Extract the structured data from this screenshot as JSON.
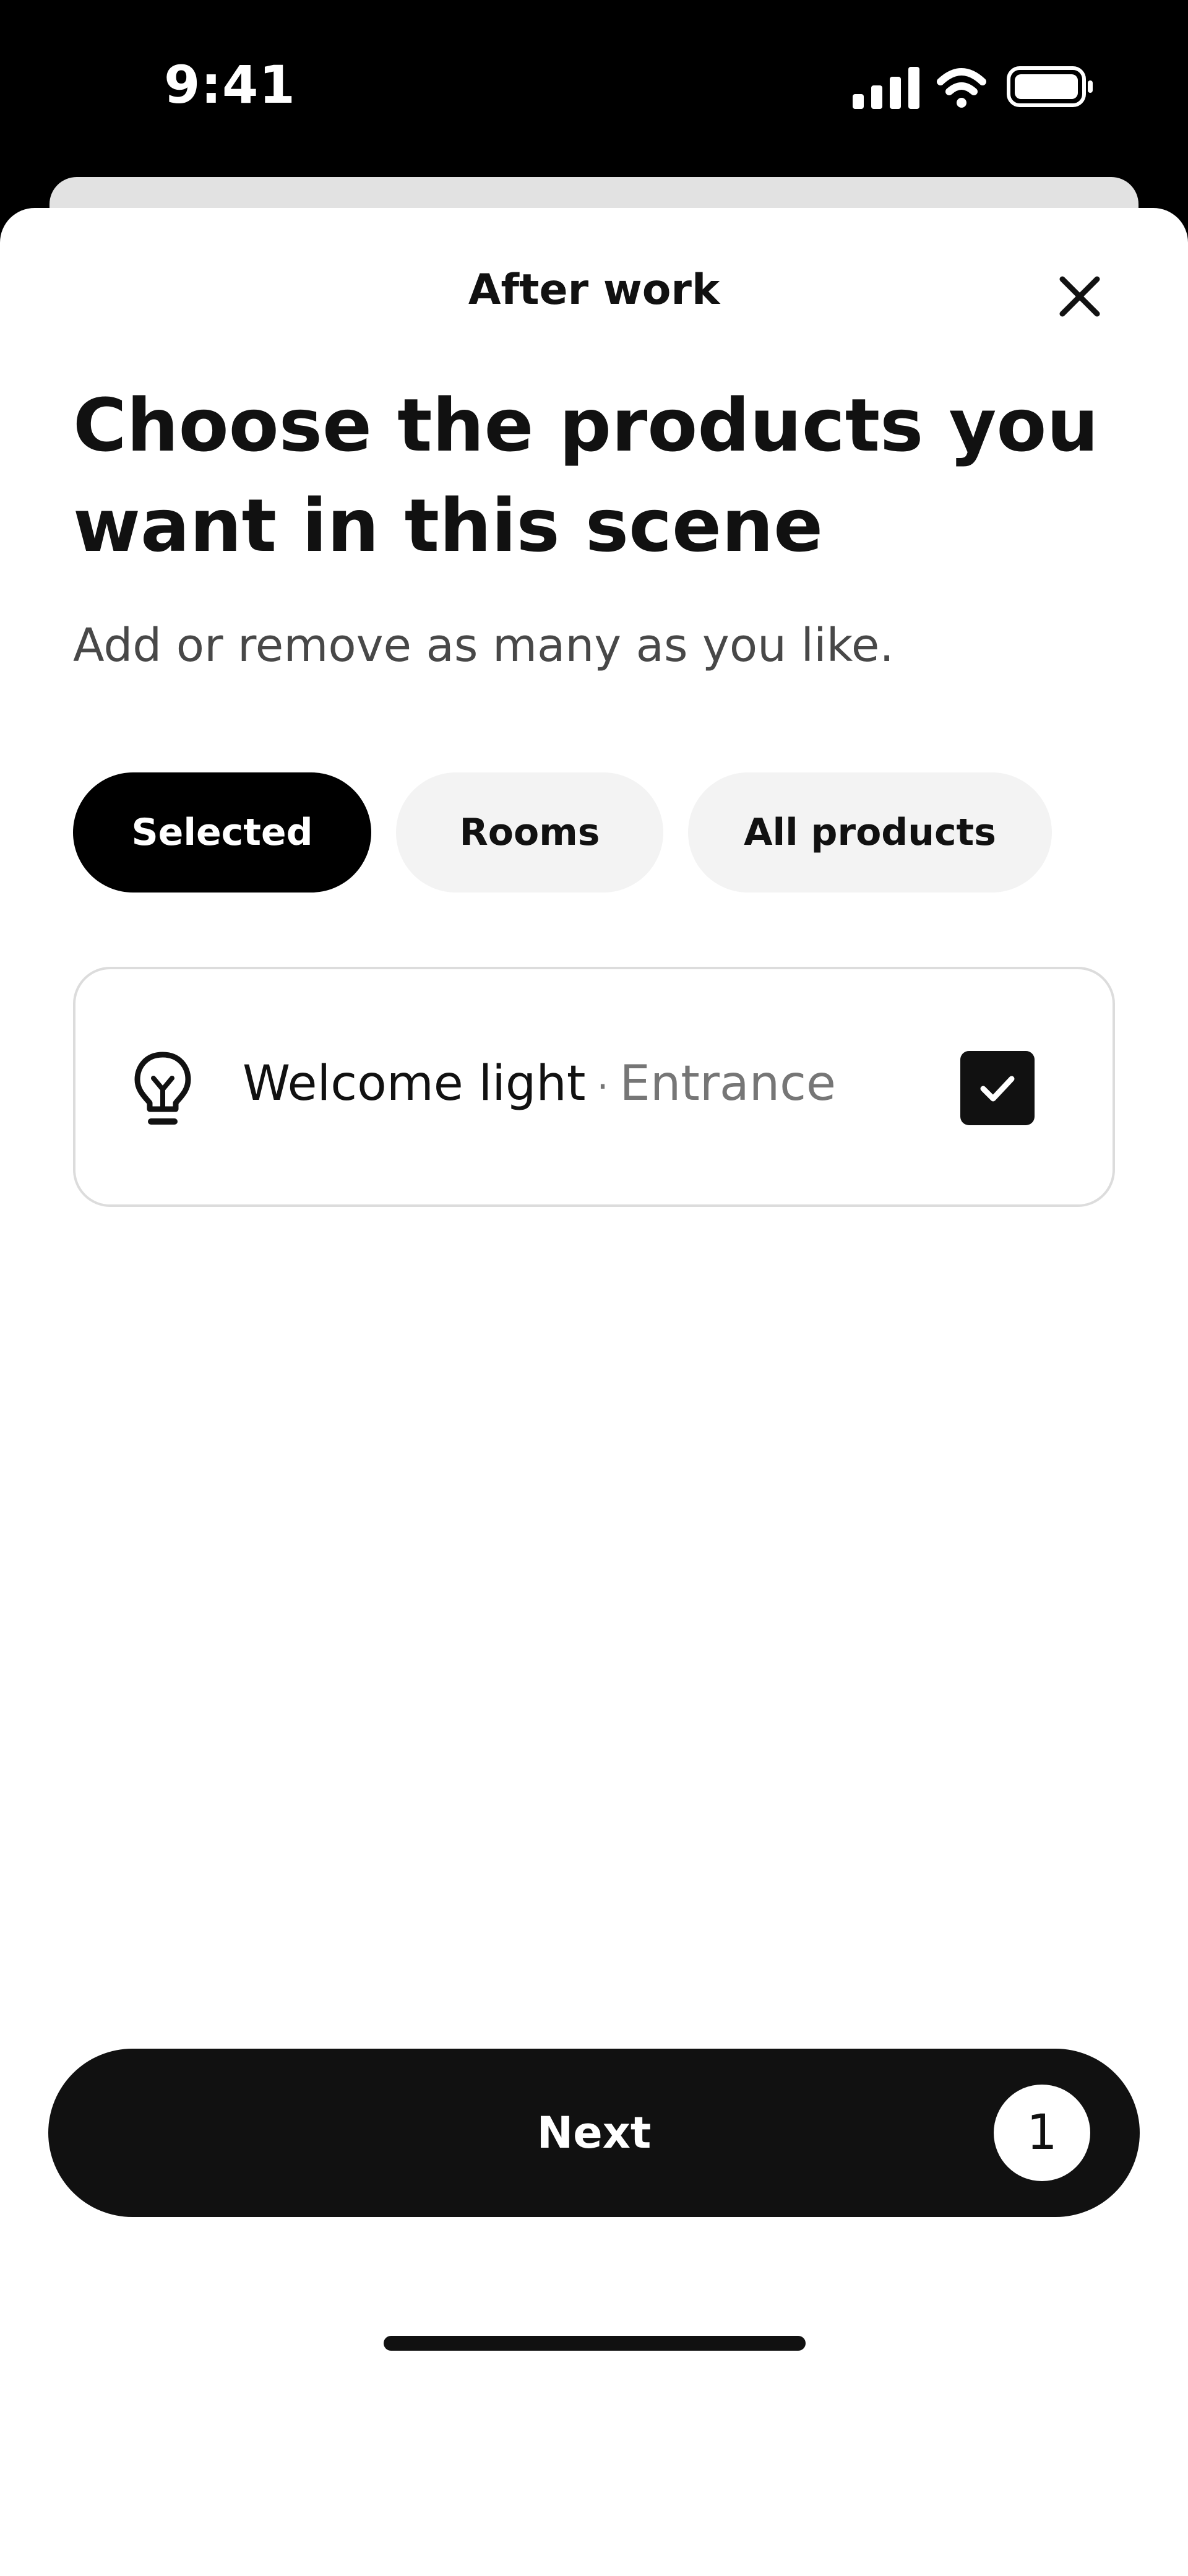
{
  "status_bar": {
    "time": "9:41",
    "icons": [
      "cellular-signal-icon",
      "wifi-icon",
      "battery-icon"
    ]
  },
  "sheet": {
    "title": "After work",
    "close_icon": "close-icon"
  },
  "heading": {
    "line1": "Choose the products you",
    "line2": "want in this scene"
  },
  "subtext": "Add or remove as many as you like.",
  "tabs": [
    {
      "label": "Selected",
      "active": true
    },
    {
      "label": "Rooms",
      "active": false
    },
    {
      "label": "All products",
      "active": false
    }
  ],
  "products": [
    {
      "name": "Welcome light",
      "separator": "·",
      "room": "Entrance",
      "icon": "light-bulb-icon",
      "checked": true
    }
  ],
  "next_button": {
    "label": "Next",
    "count": "1"
  },
  "colors": {
    "primary": "#111111",
    "tab_inactive": "#f3f3f3",
    "muted_text": "#767676",
    "background": "#ffffff"
  }
}
